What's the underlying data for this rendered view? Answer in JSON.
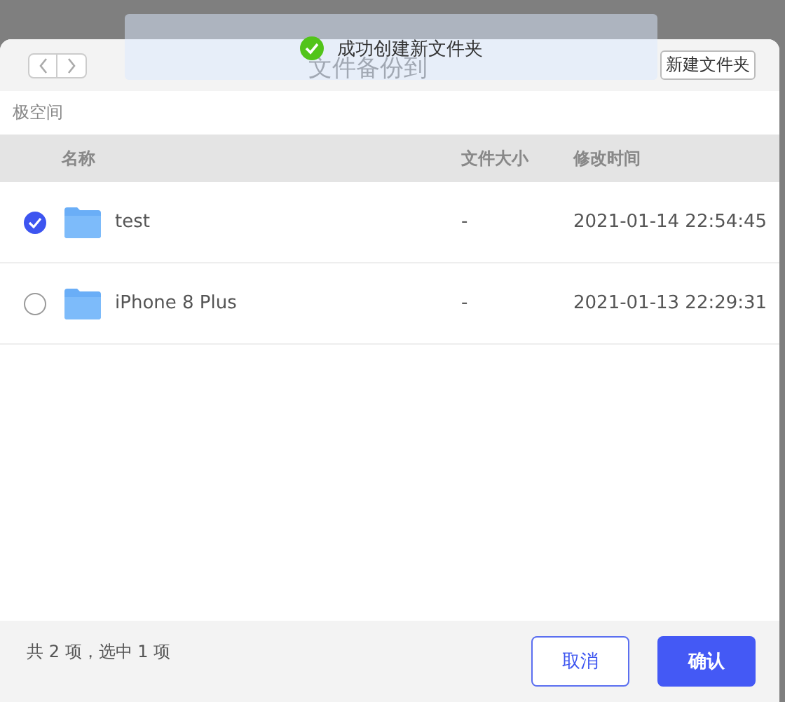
{
  "toast": {
    "message": "成功创建新文件夹"
  },
  "dialog": {
    "title": "文件备份到",
    "new_folder_button": "新建文件夹"
  },
  "breadcrumb": "极空间",
  "table": {
    "columns": [
      "名称",
      "文件大小",
      "修改时间"
    ],
    "rows": [
      {
        "name": "test",
        "size": "-",
        "modified": "2021-01-14 22:54:45",
        "selected": true
      },
      {
        "name": "iPhone 8 Plus",
        "size": "-",
        "modified": "2021-01-13 22:29:31",
        "selected": false
      }
    ]
  },
  "footer": {
    "summary": "共 2 项，选中 1 项",
    "buttons": [
      {
        "label": "取消",
        "kind": "secondary"
      },
      {
        "label": "确认",
        "kind": "primary"
      }
    ]
  }
}
